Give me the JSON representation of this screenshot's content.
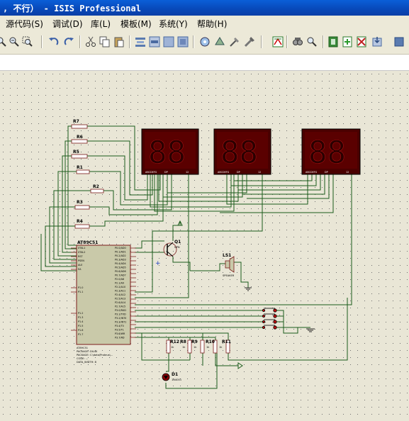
{
  "window": {
    "title": ", 不行） - ISIS Professional",
    "accent": "#0a48b8",
    "canvas_bg": "#e9e6d6",
    "wire_color": "#1c5c1c",
    "display_color": "#5a0000"
  },
  "menu": [
    {
      "label": "源代码(S)"
    },
    {
      "label": "调试(D)"
    },
    {
      "label": "库(L)"
    },
    {
      "label": "模板(M)"
    },
    {
      "label": "系统(Y)"
    },
    {
      "label": "帮助(H)"
    }
  ],
  "toolbar": [
    "zoom-in-icon",
    "zoom-area-icon",
    "undo-icon",
    "redo-icon",
    "cut-icon",
    "copy-icon",
    "paste-icon",
    "align-icon",
    "block-copy-icon",
    "block-move-icon",
    "block-delete-icon",
    "pick-device-icon",
    "make-device-icon",
    "decompose-icon",
    "wire-autorouter-icon",
    "search-tag-icon",
    "property-assign-icon",
    "netlist-icon",
    "add-sheet-icon",
    "remove-sheet-icon",
    "export-icon"
  ],
  "schematic": {
    "resistors_top": [
      "R7",
      "R6",
      "R5",
      "R1",
      "R2",
      "R3",
      "R4"
    ],
    "mcu": {
      "name": "AT89C51",
      "left_pins": [
        "XTAL1",
        "XTAL2",
        "RST",
        "PSEN",
        "ALE",
        "EA",
        "P1.0",
        "P1.1",
        "P1.2",
        "P1.3",
        "P1.4",
        "P1.5",
        "P1.6",
        "P1.7"
      ],
      "right_pins": [
        "P0.0/AD0",
        "P0.1/AD1",
        "P0.2/AD2",
        "P0.3/AD3",
        "P0.4/AD4",
        "P0.5/AD5",
        "P0.6/AD6",
        "P0.7/AD7",
        "P2.0/A8",
        "P2.1/A9",
        "P2.2/A10",
        "P2.3/A11",
        "P2.4/A12",
        "P2.5/A13",
        "P2.6/A14",
        "P2.7/A15",
        "P3.0/RXD",
        "P3.1/TXD",
        "P3.2/INT0",
        "P3.3/INT1",
        "P3.4/T0",
        "P3.5/T1",
        "P3.6/WR",
        "P3.7/RD"
      ],
      "footer": [
        "AT89C51",
        "PACKAGE: DIL40",
        "PACKAGE: C:\\data\\Proteus\\...",
        "CODE: ...",
        "DATA_WIDTH: 8"
      ]
    },
    "transistor": {
      "ref": "Q1",
      "type": "NPN"
    },
    "buzzer": {
      "ref": "LS1",
      "type": "SPEAKER"
    },
    "bottom_resistors": [
      "R12",
      "R8",
      "R9",
      "R10",
      "R11"
    ],
    "bottom_res_values": [
      "1k",
      "1k",
      "1k",
      "1k",
      "1k"
    ],
    "diode": {
      "ref": "D1",
      "type": "1N4001"
    },
    "display_pins": [
      "A",
      "B",
      "C",
      "D",
      "E",
      "F",
      "G",
      "DP",
      "1",
      "2"
    ],
    "display_labels": {
      "segs": "ABCDEFG",
      "dp": "DP",
      "digits": "12"
    }
  }
}
